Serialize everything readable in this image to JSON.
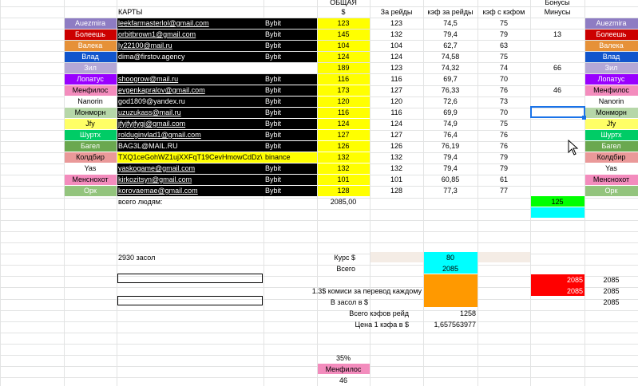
{
  "header": {
    "cards": "КАРТЫ",
    "total_top": "ОБЩАЯ",
    "total_unit": "$",
    "per_raid": "За рейды",
    "kf_per_raid": "кэф за рейды",
    "kf_with_kf": "кэф с кэфом",
    "bonus": "Бонусы",
    "minus": "Минусы"
  },
  "colors": {
    "black": "#000000",
    "yellow": "#ffff00",
    "green": "#00ff00",
    "cyan": "#00ffff",
    "orange": "#ff9900",
    "red": "#ff0000",
    "pink": "#f38cbd",
    "beige": "#f4ece5"
  },
  "rows": [
    {
      "name": "Auezmira",
      "bg": "#8e7cc3",
      "fg": "#ffffff",
      "email": "leekfarmasterlol@gmail.com",
      "ex": "Bybit",
      "total": "123",
      "raids": "123",
      "kf": "74,5",
      "kfk": "75",
      "bonus": "",
      "side": "Auezmira"
    },
    {
      "name": "Болеешь",
      "bg": "#cc0000",
      "fg": "#ffffff",
      "email": "orbitbrown1@gmail.com",
      "ex": "Bybit",
      "total": "145",
      "raids": "132",
      "kf": "79,4",
      "kfk": "79",
      "bonus": "13",
      "side": "Болеешь"
    },
    {
      "name": "Валека",
      "bg": "#e69138",
      "fg": "#ffffff",
      "email": "ly22100@mail.ru",
      "ex": "Bybit",
      "total": "104",
      "raids": "104",
      "kf": "62,7",
      "kfk": "63",
      "bonus": "",
      "side": "Валека"
    },
    {
      "name": "Влад",
      "bg": "#1155cc",
      "fg": "#ffffff",
      "email": "dima@firstov.agency",
      "ex": "Bybit",
      "total": "124",
      "raids": "124",
      "kf": "74,58",
      "kfk": "75",
      "bonus": "",
      "side": "Влад"
    },
    {
      "name": "Зил",
      "bg": "#b4a7d6",
      "fg": "#ffffff",
      "email": "",
      "ex": "",
      "total": "189",
      "raids": "123",
      "kf": "74,32",
      "kfk": "74",
      "bonus": "66",
      "side": "Зил"
    },
    {
      "name": "Лопатус",
      "bg": "#9900ff",
      "fg": "#ffffff",
      "email": "shoogrow@mail.ru",
      "ex": "Bybit",
      "total": "116",
      "raids": "116",
      "kf": "69,7",
      "kfk": "70",
      "bonus": "",
      "side": "Лопатус"
    },
    {
      "name": "Менфилос",
      "bg": "#f38cbd",
      "fg": "#000000",
      "email": "evgenkapralov@gmail.com",
      "ex": "Bybit",
      "total": "173",
      "raids": "127",
      "kf": "76,33",
      "kfk": "76",
      "bonus": "46",
      "side": "Менфилос"
    },
    {
      "name": "Nanorin",
      "bg": "#ffffff",
      "fg": "#000000",
      "email": "god1809@yandex.ru",
      "ex": "Bybit",
      "total": "120",
      "raids": "120",
      "kf": "72,6",
      "kfk": "73",
      "bonus": "",
      "side": "Nanorin"
    },
    {
      "name": "Монморн",
      "bg": "#b6d7a8",
      "fg": "#000000",
      "email": "uzuzukass@mail.ru",
      "ex": "Bybit",
      "total": "116",
      "raids": "116",
      "kf": "69,9",
      "kfk": "70",
      "bonus": "",
      "side": "Монморн"
    },
    {
      "name": "Jfy",
      "bg": "#ffff66",
      "fg": "#000000",
      "email": "jfyjfyjfygj@gmail.com",
      "ex": "Bybit",
      "total": "124",
      "raids": "124",
      "kf": "74,9",
      "kfk": "75",
      "bonus": "",
      "side": "Jfy"
    },
    {
      "name": "Шуртх",
      "bg": "#00cc66",
      "fg": "#ffffff",
      "email": "rolduginvlad1@gmail.com",
      "ex": "Bybit",
      "total": "127",
      "raids": "127",
      "kf": "76,4",
      "kfk": "76",
      "bonus": "",
      "side": "Шуртх"
    },
    {
      "name": "Багел",
      "bg": "#6aa84f",
      "fg": "#ffffff",
      "email": "BAG3L@MAIL.RU",
      "ex": "Bybit",
      "total": "126",
      "raids": "126",
      "kf": "76,19",
      "kfk": "76",
      "bonus": "",
      "side": "Багел"
    },
    {
      "name": "Колдбир",
      "bg": "#ea9999",
      "fg": "#000000",
      "email": "TXQ1ceGohWZ1ujXXFqT19CevHmowCdDz\\",
      "ex": "binance",
      "total": "132",
      "raids": "132",
      "kf": "79,4",
      "kfk": "79",
      "bonus": "",
      "side": "Колдбир"
    },
    {
      "name": "Yas",
      "bg": "#ffffff",
      "fg": "#000000",
      "email": "yaskogame@gmail.com",
      "ex": "Bybit",
      "total": "132",
      "raids": "132",
      "kf": "79,4",
      "kfk": "79",
      "bonus": "",
      "side": "Yas"
    },
    {
      "name": "Менснохот",
      "bg": "#f38cbd",
      "fg": "#000000",
      "email": "kirkozitsyn@gmail.com",
      "ex": "Bybit",
      "total": "101",
      "raids": "101",
      "kf": "60,85",
      "kfk": "61",
      "bonus": "",
      "side": "Менснохот"
    },
    {
      "name": "Орк",
      "bg": "#93c47d",
      "fg": "#ffffff",
      "email": "korovaemae@gmail.com",
      "ex": "Bybit",
      "total": "128",
      "raids": "128",
      "kf": "77,3",
      "kfk": "77",
      "bonus": "",
      "side": "Орк"
    }
  ],
  "summary": {
    "people_label": "всего людям:",
    "people_total": "2085,00",
    "bonus_total": "125",
    "zasol_label": "2930 засол",
    "rate_label": "Курс $",
    "rate_value": "80",
    "total_label": "Всего",
    "total_value": "2085",
    "commission_label": "1.3$ комиси за перевод каждому",
    "to_zasol_label": "В засол в $",
    "kf_total_label": "Всего кэфов  рейд",
    "kf_total_value": "1258",
    "kf_price_label": "Цена 1 кэфа в $",
    "kf_price_value": "1,657563977",
    "red_1": "2085",
    "red_2": "2085",
    "right_1": "2085",
    "right_2": "2085",
    "right_3": "2085",
    "percent": "35%",
    "pink_name": "Менфилос",
    "pink_value": "46"
  }
}
